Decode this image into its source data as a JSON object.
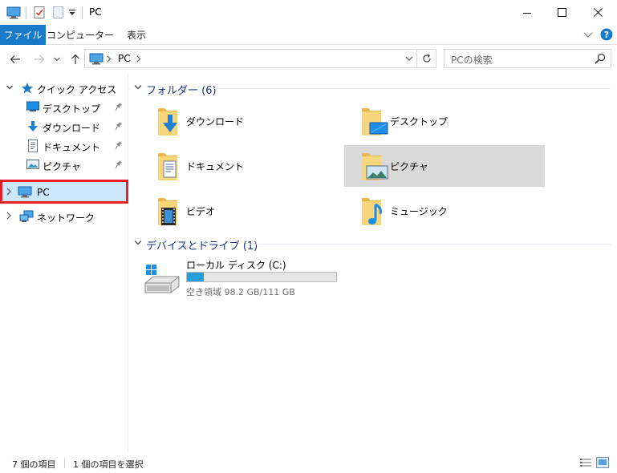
{
  "window": {
    "title": "PC"
  },
  "ribbon": {
    "tabs": [
      {
        "label": "ファイル"
      },
      {
        "label": "コンピューター"
      },
      {
        "label": "表示"
      }
    ]
  },
  "address": {
    "crumbs": [
      "PC"
    ]
  },
  "search": {
    "placeholder": "PCの検索"
  },
  "nav": {
    "quick_access": "クイック アクセス",
    "pinned": [
      {
        "label": "デスクトップ",
        "icon": "desktop-icon"
      },
      {
        "label": "ダウンロード",
        "icon": "download-icon"
      },
      {
        "label": "ドキュメント",
        "icon": "document-icon"
      },
      {
        "label": "ピクチャ",
        "icon": "picture-icon"
      }
    ],
    "pc": "PC",
    "network": "ネットワーク"
  },
  "folders_group": {
    "label": "フォルダー (6)",
    "items": [
      {
        "label": "ダウンロード",
        "icon": "download-folder-icon"
      },
      {
        "label": "デスクトップ",
        "icon": "desktop-folder-icon"
      },
      {
        "label": "ドキュメント",
        "icon": "document-folder-icon"
      },
      {
        "label": "ピクチャ",
        "icon": "picture-folder-icon",
        "selected": true
      },
      {
        "label": "ビデオ",
        "icon": "video-folder-icon"
      },
      {
        "label": "ミュージック",
        "icon": "music-folder-icon"
      }
    ]
  },
  "drives_group": {
    "label": "デバイスとドライブ (1)",
    "drive": {
      "label": "ローカル ディスク (C:)",
      "space": "空き領域 98.2 GB/111 GB",
      "used_fraction": 0.115
    }
  },
  "status": {
    "item_count": "7 個の項目",
    "selected": "1 個の項目を選択"
  },
  "colors": {
    "accent": "#1979ca",
    "selection": "#cce8ff",
    "highlight_box": "#e8202a",
    "drive_fill": "#26a0da",
    "group_header": "#1e3287"
  }
}
